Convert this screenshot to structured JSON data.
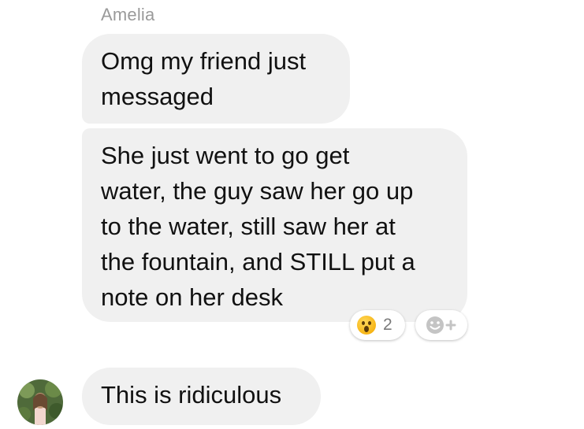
{
  "thread": {
    "sender_name": "Amelia",
    "messages": [
      {
        "text": "Omg my friend just\nmessaged"
      },
      {
        "text": "She just went to go get\nwater, the guy saw her go up\nto the water, still saw her at\nthe fountain, and STILL put a\nnote on her desk"
      },
      {
        "text": "This is ridiculous"
      }
    ],
    "reaction": {
      "emoji": "surprised-face-icon",
      "count": "2"
    },
    "add_reaction_icon": "add-reaction-icon"
  },
  "colors": {
    "bubble_bg": "#f0f0f0",
    "text": "#111111",
    "name_gray": "#9a9a9a",
    "emoji_yellow": "#f7b516"
  }
}
